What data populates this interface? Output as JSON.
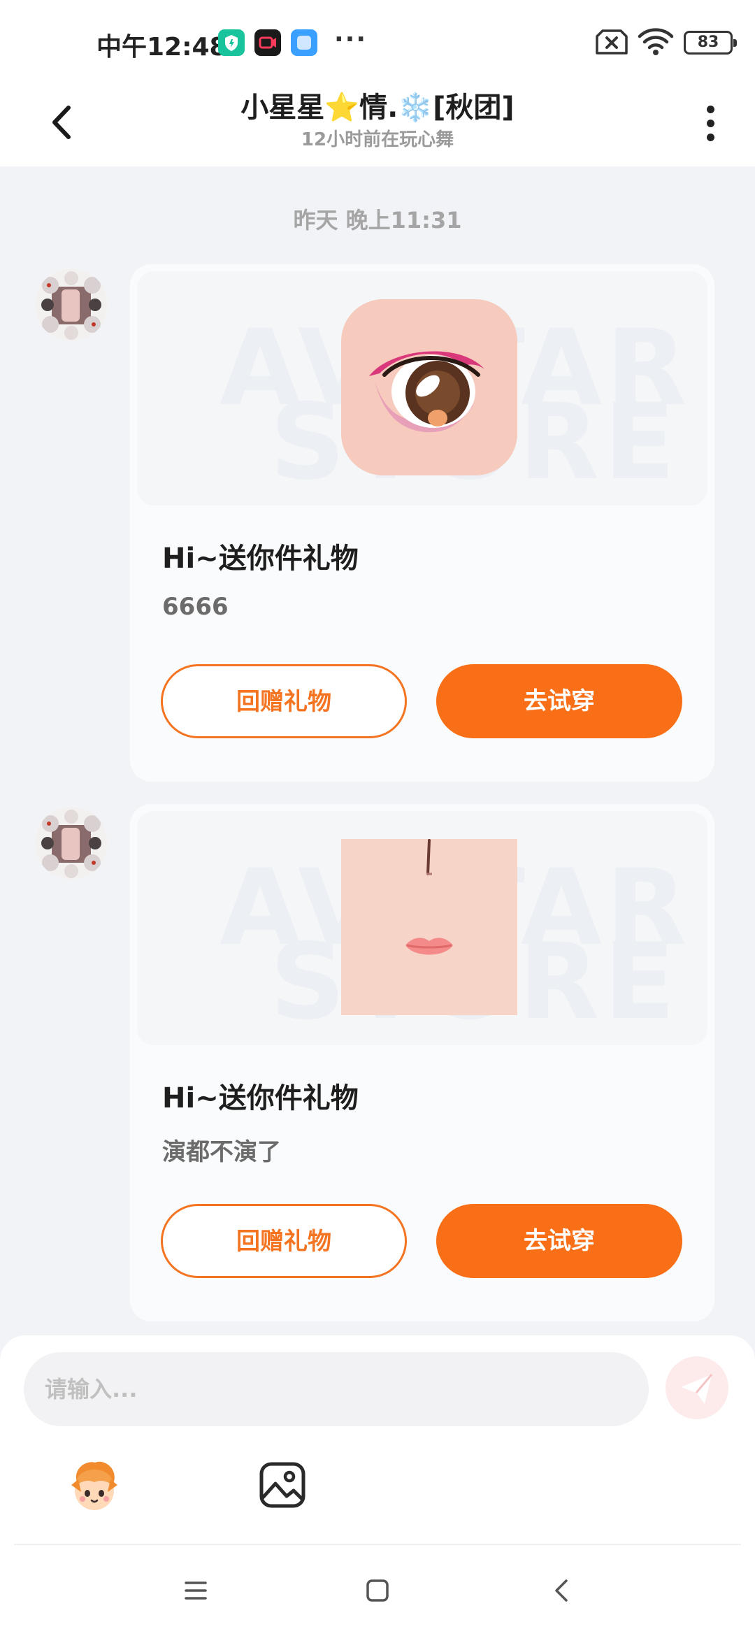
{
  "status_bar": {
    "time": "中午12:48",
    "more": "···",
    "battery": "83",
    "icons": [
      "shield-app-icon",
      "video-app-icon",
      "cloud-app-icon",
      "no-sim-icon",
      "wifi-icon",
      "battery-icon"
    ]
  },
  "header": {
    "title": "小星星⭐情.❄️[秋团]",
    "subtitle": "12小时前在玩心舞",
    "icons": [
      "back-arrow-icon",
      "more-vertical-icon"
    ]
  },
  "chat": {
    "date_separator": "昨天 晚上11:31",
    "messages": [
      {
        "gift_image": "eye-makeup-gift",
        "title": "Hi~送你件礼物",
        "message": "6666",
        "return_label": "回赠礼物",
        "try_label": "去试穿"
      },
      {
        "gift_image": "mouth-makeup-gift",
        "title": "Hi~送你件礼物",
        "message": "演都不演了",
        "return_label": "回赠礼物",
        "try_label": "去试穿"
      }
    ]
  },
  "composer": {
    "placeholder": "请输入...",
    "icons": [
      "send-icon",
      "sticker-icon",
      "image-icon"
    ]
  },
  "nav": {
    "icons": [
      "menu-icon",
      "home-icon",
      "back-icon"
    ]
  },
  "colors": {
    "accent": "#f86f17",
    "background": "#f1f3f6",
    "card": "#fafbfc"
  }
}
